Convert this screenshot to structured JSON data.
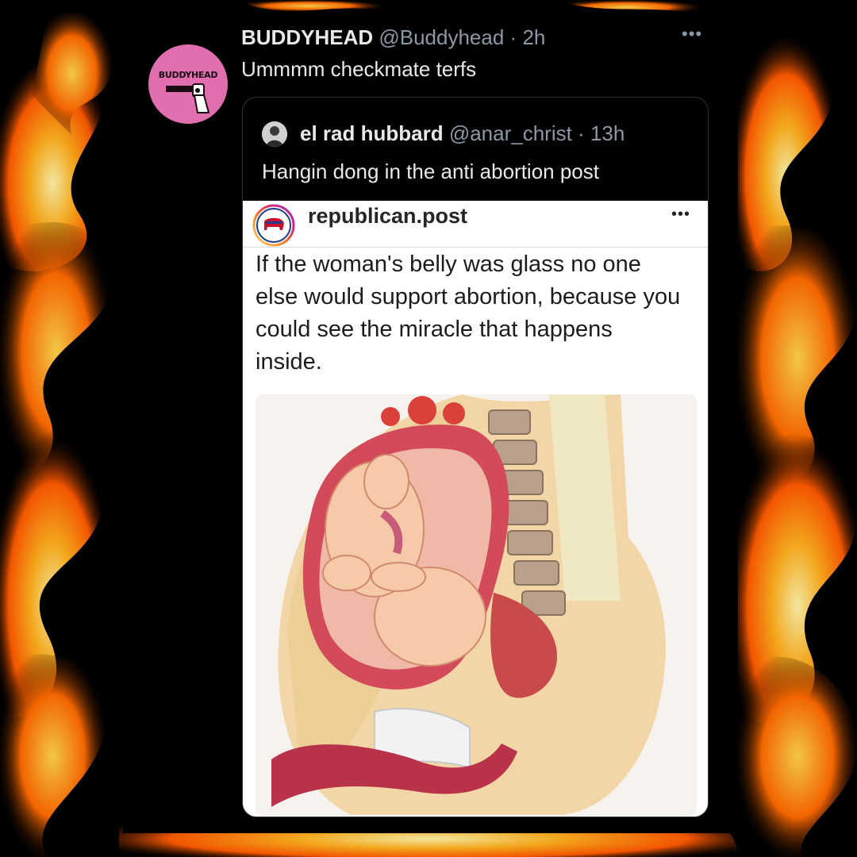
{
  "tweet": {
    "author": {
      "name": "BUDDYHEAD",
      "handle": "@Buddyhead",
      "avatar_text": "BUDDYHEAD",
      "avatar_color": "#e16fb0"
    },
    "separator": " · ",
    "time": "2h",
    "text": "Ummmm checkmate terfs",
    "more_icon": "more-horizontal-icon"
  },
  "quoted_tweet": {
    "author": {
      "name": "el rad hubbard",
      "handle": "@anar_christ"
    },
    "separator": " · ",
    "time": "13h",
    "text": "Hangin dong in the anti abortion post"
  },
  "embedded_post": {
    "account": "republican.post",
    "more_icon": "more-horizontal-icon",
    "caption": "If the woman's belly was glass no one else would support abortion, because you could see the miracle that happens inside."
  },
  "colors": {
    "background": "#000000",
    "text_primary": "#e7e9ea",
    "text_secondary": "#8b98a5",
    "border": "#2f3336",
    "fire": "#ff7a00"
  }
}
